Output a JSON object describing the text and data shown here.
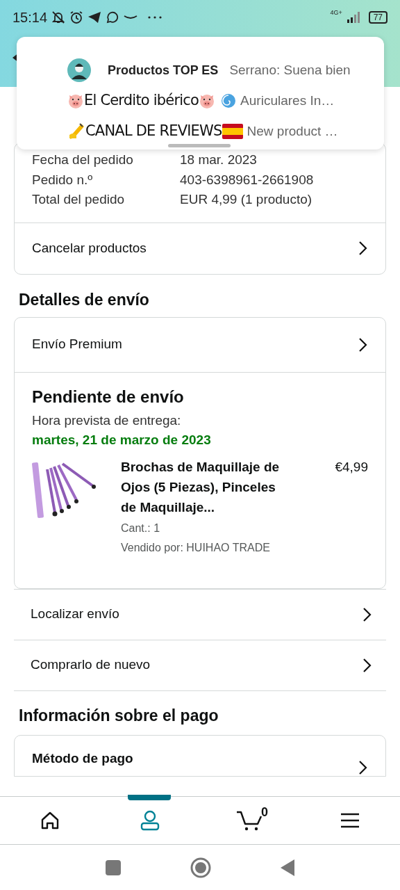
{
  "status_bar": {
    "time": "15:14",
    "network": "4G+",
    "battery": "77"
  },
  "notification": {
    "items": [
      {
        "kind": "avatar",
        "title": "Productos TOP ES",
        "text": "Serrano: Suena bien"
      },
      {
        "kind": "pig",
        "title": "El Cerdito ibérico",
        "text": "Auriculares In…"
      },
      {
        "kind": "writing",
        "title": "CANAL DE REVIEWS",
        "text": "New product …"
      }
    ]
  },
  "order_summary": {
    "rows": [
      {
        "label": "Fecha del pedido",
        "value": "18 mar. 2023"
      },
      {
        "label": "Pedido n.º",
        "value": "403-6398961-2661908"
      },
      {
        "label": "Total del pedido",
        "value": "EUR 4,99 (1 producto)"
      }
    ],
    "action": "Cancelar productos"
  },
  "shipping": {
    "heading": "Detalles de envío",
    "method": "Envío Premium",
    "status": "Pendiente de envío",
    "eta_label": "Hora prevista de entrega:",
    "eta_date": "martes, 21 de marzo de 2023",
    "product": {
      "kind": "picture",
      "title": "Brochas de Maquillaje de Ojos (5 Piezas), Pinceles de Maquillaje...",
      "price": "€4,99",
      "quantity": "Cant.: 1",
      "seller": "Vendido por: HUIHAO TRADE"
    },
    "actions": [
      "Localizar envío",
      "Comprarlo de nuevo"
    ]
  },
  "payment": {
    "heading": "Información sobre el pago",
    "method_label": "Método de pago"
  },
  "bottom_nav": [
    {
      "kind": "home",
      "selected": false
    },
    {
      "kind": "account",
      "selected": true
    },
    {
      "kind": "cart",
      "selected": false,
      "count": "0"
    },
    {
      "kind": "menu",
      "selected": false
    }
  ]
}
